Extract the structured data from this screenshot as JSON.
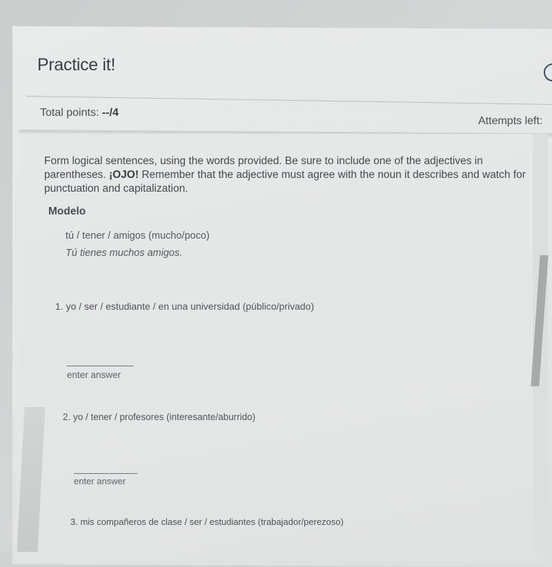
{
  "header": {
    "title": "Practice it!",
    "help_icon": "help-circle-icon",
    "total_points_label": "Total points:",
    "total_points_value": "--/4",
    "attempts_left_label": "Attempts left:"
  },
  "instructions": {
    "part1": "Form logical sentences, using the words provided. Be sure to include one of the adjectives in parentheses.",
    "ojo": "¡OJO!",
    "part2": "Remember that the adjective must agree with the noun it describes and watch for punctuation and capitalization."
  },
  "modelo": {
    "label": "Modelo",
    "prompt": "tú / tener / amigos (mucho/poco)",
    "answer": "Tú tienes muchos amigos."
  },
  "questions": [
    {
      "text": "1. yo / ser / estudiante / en una universidad (público/privado)",
      "answer_value": "",
      "answer_hint": "enter answer"
    },
    {
      "text": "2. yo / tener / profesores (interesante/aburrido)",
      "answer_value": "",
      "answer_hint": "enter answer"
    },
    {
      "text": "3. mis compañeros de clase / ser / estudiantes (trabajador/perezoso)"
    }
  ]
}
